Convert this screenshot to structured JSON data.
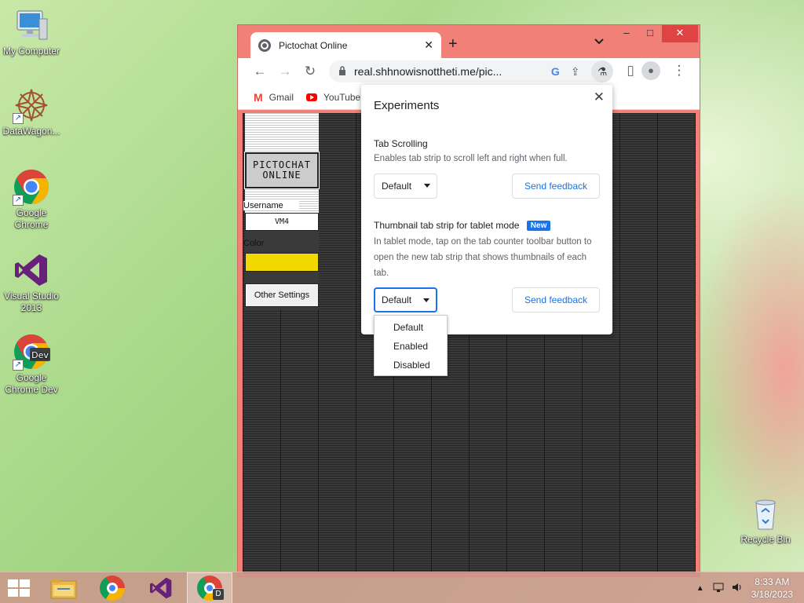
{
  "desktop": {
    "icons": [
      {
        "label": "My Computer"
      },
      {
        "label": "DataWagon..."
      },
      {
        "label": "Google Chrome"
      },
      {
        "label": "Visual Studio 2013"
      },
      {
        "label": "Google Chrome Dev"
      },
      {
        "label": "Recycle Bin"
      }
    ]
  },
  "browser": {
    "tab_title": "Pictochat Online",
    "url": "real.shhnowisnottheti.me/pic...",
    "bookmarks": [
      {
        "label": "Gmail"
      },
      {
        "label": "YouTube"
      }
    ],
    "titlebar": {
      "minimize": "–",
      "maximize": "□",
      "close": "✕",
      "new_tab": "+",
      "tab_search": "⌄"
    }
  },
  "pictochat": {
    "logo_line1": "PICTOCHAT",
    "logo_line2": "ONLINE",
    "username_label": "Username",
    "username_value": "VM4",
    "color_label": "Color",
    "color_value": "#f1d900",
    "other_settings": "Other Settings"
  },
  "experiments": {
    "title": "Experiments",
    "items": [
      {
        "name": "Tab Scrolling",
        "description": "Enables tab strip to scroll left and right when full.",
        "selected": "Default",
        "feedback": "Send feedback"
      },
      {
        "name": "Thumbnail tab strip for tablet mode",
        "badge": "New",
        "description": "In tablet mode, tap on the tab counter toolbar button to open the new tab strip that shows thumbnails of each tab.",
        "selected": "Default",
        "feedback": "Send feedback"
      }
    ],
    "dropdown_options": [
      "Default",
      "Enabled",
      "Disabled"
    ]
  },
  "taskbar": {
    "time": "8:33 AM",
    "date": "3/18/2023"
  },
  "colors": {
    "window_frame": "#f08078",
    "accent": "#1a73e8",
    "canvas": "#3a3a3a"
  }
}
